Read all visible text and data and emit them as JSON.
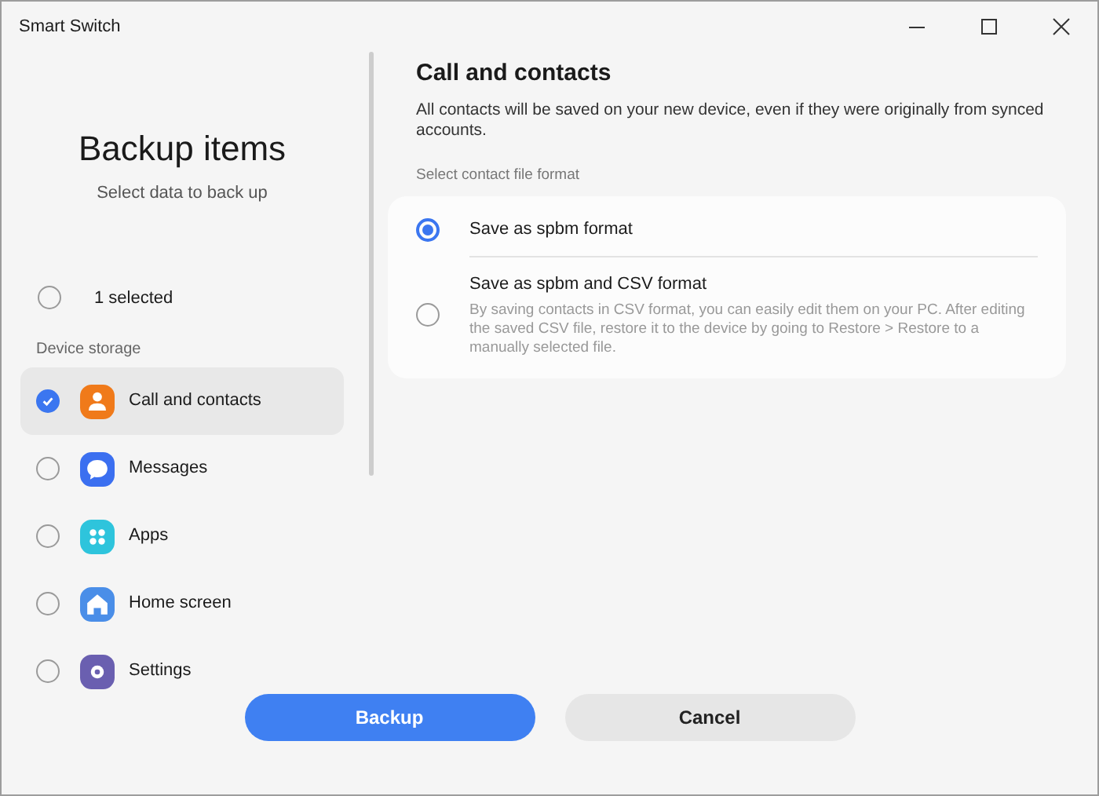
{
  "window": {
    "title": "Smart Switch"
  },
  "sidebar": {
    "title": "Backup items",
    "subtitle": "Select data to back up",
    "select_all": {
      "label": "1 selected",
      "checked": false
    },
    "section": "Device storage",
    "items": [
      {
        "label": "Call and contacts",
        "kind": "person",
        "color": "#f07a1a",
        "checked": true,
        "selected": true
      },
      {
        "label": "Messages",
        "kind": "chat",
        "color": "#3b6ff0",
        "checked": false,
        "selected": false
      },
      {
        "label": "Apps",
        "kind": "apps",
        "color": "#2ec4dc",
        "checked": false,
        "selected": false
      },
      {
        "label": "Home screen",
        "kind": "home",
        "color": "#4a8ee8",
        "checked": false,
        "selected": false
      },
      {
        "label": "Settings",
        "kind": "gear",
        "color": "#6a5fb0",
        "checked": false,
        "selected": false
      }
    ]
  },
  "detail": {
    "title": "Call and contacts",
    "description": "All contacts will be saved on your new device, even if they were originally from synced accounts.",
    "format_label": "Select contact file format",
    "options": [
      {
        "label": "Save as spbm format",
        "selected": true
      },
      {
        "label": "Save as spbm and CSV format",
        "note": "By saving contacts in CSV format, you can easily edit them on your PC. After editing the saved CSV file, restore it to the device by going to Restore > Restore to a manually selected file.",
        "selected": false
      }
    ]
  },
  "buttons": [
    {
      "label": "Backup",
      "kind": "primary"
    },
    {
      "label": "Cancel",
      "kind": "secondary"
    }
  ]
}
